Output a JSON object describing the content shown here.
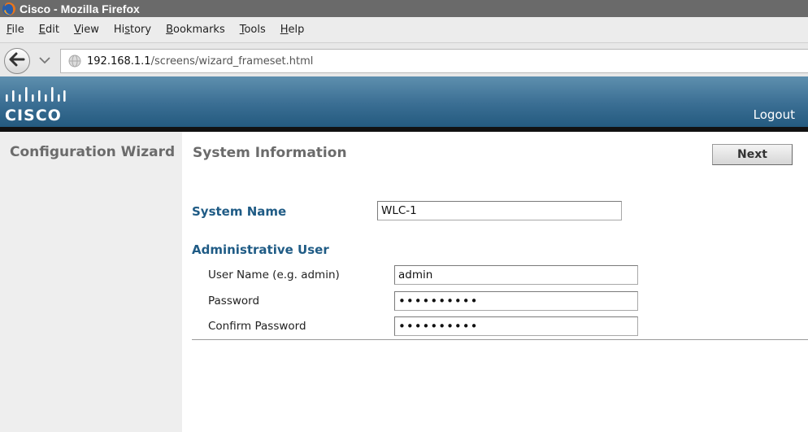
{
  "window": {
    "title": "Cisco - Mozilla Firefox"
  },
  "menu": [
    {
      "prefix": "",
      "underline": "F",
      "rest": "ile"
    },
    {
      "prefix": "",
      "underline": "E",
      "rest": "dit"
    },
    {
      "prefix": "",
      "underline": "V",
      "rest": "iew"
    },
    {
      "prefix": "Hi",
      "underline": "s",
      "rest": "tory"
    },
    {
      "prefix": "",
      "underline": "B",
      "rest": "ookmarks"
    },
    {
      "prefix": "",
      "underline": "T",
      "rest": "ools"
    },
    {
      "prefix": "",
      "underline": "H",
      "rest": "elp"
    }
  ],
  "address": {
    "host": "192.168.1.1",
    "path": "/screens/wizard_frameset.html"
  },
  "header": {
    "logo_text": "CISCO",
    "logout": "Logout"
  },
  "sidebar": {
    "title": "Configuration Wizard"
  },
  "main": {
    "title": "System Information",
    "next_label": "Next",
    "system_name_label": "System Name",
    "system_name_value": "WLC-1",
    "admin_section_label": "Administrative User",
    "username_label": "User Name (e.g. admin)",
    "username_value": "admin",
    "password_label": "Password",
    "password_value": "••••••••••",
    "confirm_label": "Confirm Password",
    "confirm_value": "••••••••••"
  },
  "colors": {
    "header_blue": "#3a6e93",
    "section_label": "#1f5b85",
    "title_gray": "#6b6b6b"
  }
}
